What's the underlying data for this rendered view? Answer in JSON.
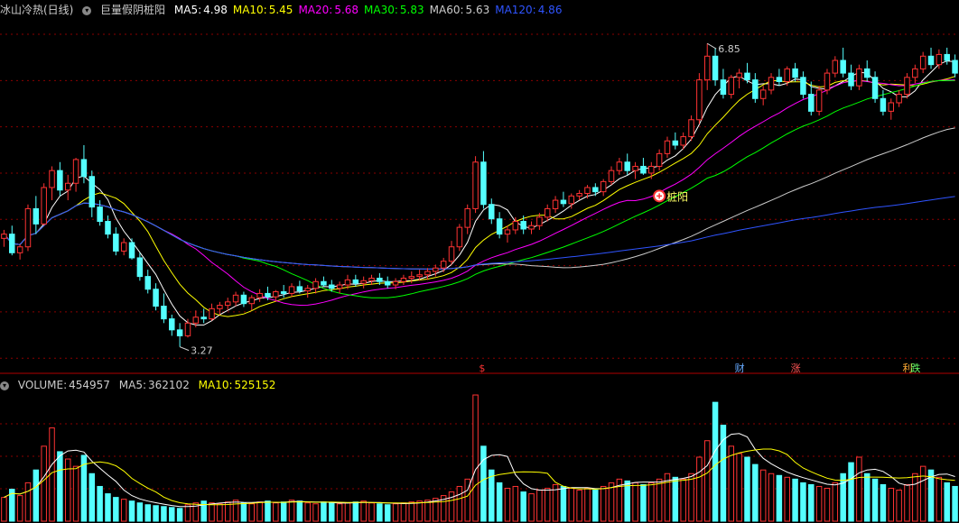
{
  "header": {
    "title": "冰山冷热(日线)",
    "indicator": "巨量假阴桩阳",
    "ma": [
      {
        "label": "MA5:",
        "value": "4.98",
        "color": "#ffffff"
      },
      {
        "label": "MA10:",
        "value": "5.45",
        "color": "#ffff00"
      },
      {
        "label": "MA20:",
        "value": "5.68",
        "color": "#ff00ff"
      },
      {
        "label": "MA30:",
        "value": "5.83",
        "color": "#00ff00"
      },
      {
        "label": "MA60:",
        "value": "5.63",
        "color": "#cccccc"
      },
      {
        "label": "MA120:",
        "value": "4.86",
        "color": "#2f54ff"
      }
    ]
  },
  "vol_header": {
    "label": "VOLUME:",
    "value": "454957",
    "ma5_label": "MA5:",
    "ma5": "362102",
    "ma10_label": "MA10:",
    "ma10": "525152"
  },
  "annotations": {
    "high": "6.85",
    "low": "3.27",
    "signal": "桩阳",
    "markers": [
      {
        "text": "$",
        "color": "#ff3333"
      },
      {
        "text": "财",
        "color": "#66aaff"
      },
      {
        "text": "涨",
        "color": "#ff5555"
      },
      {
        "text": "利",
        "color": "#ffaa33"
      },
      {
        "text": "跌",
        "color": "#66ff66"
      }
    ]
  },
  "colors": {
    "up": "#ff3333",
    "down": "#54ffff",
    "grid": "#8a0000",
    "ma120": "#2f54ff"
  },
  "chart_data": {
    "type": "candlestick",
    "price_range": [
      3.0,
      7.15
    ],
    "candles": [
      [
        4.55,
        4.65,
        4.45,
        4.6
      ],
      [
        4.6,
        4.7,
        4.35,
        4.38
      ],
      [
        4.38,
        4.48,
        4.3,
        4.45
      ],
      [
        4.45,
        4.95,
        4.4,
        4.9
      ],
      [
        4.9,
        5.05,
        4.6,
        4.72
      ],
      [
        4.72,
        5.2,
        4.7,
        5.15
      ],
      [
        5.15,
        5.4,
        5.0,
        5.35
      ],
      [
        5.35,
        5.45,
        5.05,
        5.12
      ],
      [
        5.12,
        5.3,
        5.0,
        5.2
      ],
      [
        5.2,
        5.5,
        5.1,
        5.48
      ],
      [
        5.48,
        5.65,
        5.2,
        5.28
      ],
      [
        5.28,
        5.35,
        4.8,
        4.92
      ],
      [
        4.92,
        5.0,
        4.7,
        4.75
      ],
      [
        4.75,
        4.82,
        4.55,
        4.6
      ],
      [
        4.6,
        4.68,
        4.35,
        4.4
      ],
      [
        4.4,
        4.55,
        4.35,
        4.5
      ],
      [
        4.5,
        4.55,
        4.3,
        4.32
      ],
      [
        4.32,
        4.38,
        4.05,
        4.1
      ],
      [
        4.1,
        4.18,
        3.9,
        3.95
      ],
      [
        3.95,
        4.02,
        3.7,
        3.75
      ],
      [
        3.75,
        3.9,
        3.55,
        3.6
      ],
      [
        3.6,
        3.65,
        3.4,
        3.47
      ],
      [
        3.47,
        3.55,
        3.27,
        3.4
      ],
      [
        3.4,
        3.6,
        3.38,
        3.55
      ],
      [
        3.55,
        3.7,
        3.5,
        3.62
      ],
      [
        3.62,
        3.72,
        3.55,
        3.6
      ],
      [
        3.6,
        3.78,
        3.58,
        3.72
      ],
      [
        3.72,
        3.8,
        3.65,
        3.76
      ],
      [
        3.76,
        3.85,
        3.7,
        3.8
      ],
      [
        3.8,
        3.92,
        3.75,
        3.88
      ],
      [
        3.88,
        3.92,
        3.74,
        3.78
      ],
      [
        3.78,
        3.88,
        3.7,
        3.85
      ],
      [
        3.85,
        3.95,
        3.8,
        3.9
      ],
      [
        3.9,
        3.98,
        3.82,
        3.86
      ],
      [
        3.86,
        3.94,
        3.8,
        3.92
      ],
      [
        3.92,
        4.0,
        3.85,
        3.9
      ],
      [
        3.9,
        4.02,
        3.86,
        3.98
      ],
      [
        3.98,
        4.05,
        3.9,
        3.93
      ],
      [
        3.93,
        4.0,
        3.85,
        3.96
      ],
      [
        3.96,
        4.08,
        3.9,
        4.04
      ],
      [
        4.04,
        4.1,
        3.98,
        4.0
      ],
      [
        4.0,
        4.06,
        3.92,
        3.96
      ],
      [
        3.96,
        4.04,
        3.9,
        4.0
      ],
      [
        4.0,
        4.12,
        3.95,
        4.06
      ],
      [
        4.06,
        4.12,
        3.98,
        4.02
      ],
      [
        4.02,
        4.1,
        3.96,
        4.05
      ],
      [
        4.05,
        4.12,
        4.0,
        4.08
      ],
      [
        4.08,
        4.14,
        4.0,
        4.04
      ],
      [
        4.04,
        4.1,
        3.96,
        4.0
      ],
      [
        4.0,
        4.08,
        3.95,
        4.04
      ],
      [
        4.04,
        4.12,
        4.0,
        4.08
      ],
      [
        4.08,
        4.16,
        4.02,
        4.1
      ],
      [
        4.1,
        4.18,
        4.05,
        4.12
      ],
      [
        4.12,
        4.2,
        4.06,
        4.16
      ],
      [
        4.16,
        4.24,
        4.1,
        4.2
      ],
      [
        4.2,
        4.32,
        4.15,
        4.28
      ],
      [
        4.28,
        4.52,
        4.24,
        4.45
      ],
      [
        4.45,
        4.72,
        4.4,
        4.68
      ],
      [
        4.68,
        4.95,
        4.6,
        4.9
      ],
      [
        4.9,
        5.52,
        4.85,
        5.45
      ],
      [
        5.45,
        5.58,
        4.9,
        4.95
      ],
      [
        4.95,
        5.02,
        4.72,
        4.78
      ],
      [
        4.78,
        4.86,
        4.55,
        4.6
      ],
      [
        4.6,
        4.7,
        4.5,
        4.65
      ],
      [
        4.65,
        4.8,
        4.6,
        4.75
      ],
      [
        4.75,
        4.82,
        4.6,
        4.66
      ],
      [
        4.66,
        4.75,
        4.6,
        4.7
      ],
      [
        4.7,
        4.85,
        4.65,
        4.8
      ],
      [
        4.8,
        4.95,
        4.75,
        4.9
      ],
      [
        4.9,
        5.05,
        4.85,
        5.0
      ],
      [
        5.0,
        5.1,
        4.92,
        4.96
      ],
      [
        4.96,
        5.08,
        4.9,
        5.05
      ],
      [
        5.05,
        5.12,
        5.0,
        5.08
      ],
      [
        5.08,
        5.18,
        5.02,
        5.15
      ],
      [
        5.15,
        5.2,
        5.05,
        5.1
      ],
      [
        5.1,
        5.25,
        5.05,
        5.22
      ],
      [
        5.22,
        5.4,
        5.18,
        5.35
      ],
      [
        5.35,
        5.5,
        5.3,
        5.45
      ],
      [
        5.45,
        5.55,
        5.3,
        5.35
      ],
      [
        5.35,
        5.45,
        5.25,
        5.4
      ],
      [
        5.4,
        5.5,
        5.3,
        5.32
      ],
      [
        5.32,
        5.45,
        5.25,
        5.4
      ],
      [
        5.4,
        5.6,
        5.35,
        5.55
      ],
      [
        5.55,
        5.75,
        5.5,
        5.7
      ],
      [
        5.7,
        5.8,
        5.6,
        5.65
      ],
      [
        5.65,
        5.8,
        5.6,
        5.75
      ],
      [
        5.75,
        6.0,
        5.7,
        5.95
      ],
      [
        5.95,
        6.5,
        5.9,
        6.42
      ],
      [
        6.42,
        6.85,
        6.3,
        6.7
      ],
      [
        6.7,
        6.8,
        6.35,
        6.42
      ],
      [
        6.42,
        6.55,
        6.2,
        6.25
      ],
      [
        6.25,
        6.48,
        6.2,
        6.45
      ],
      [
        6.45,
        6.55,
        6.32,
        6.5
      ],
      [
        6.5,
        6.62,
        6.38,
        6.42
      ],
      [
        6.42,
        6.5,
        6.15,
        6.2
      ],
      [
        6.2,
        6.35,
        6.12,
        6.3
      ],
      [
        6.3,
        6.5,
        6.25,
        6.45
      ],
      [
        6.45,
        6.55,
        6.35,
        6.4
      ],
      [
        6.4,
        6.58,
        6.35,
        6.55
      ],
      [
        6.55,
        6.62,
        6.4,
        6.45
      ],
      [
        6.45,
        6.52,
        6.2,
        6.25
      ],
      [
        6.25,
        6.4,
        6.0,
        6.05
      ],
      [
        6.05,
        6.35,
        6.0,
        6.3
      ],
      [
        6.3,
        6.55,
        6.25,
        6.5
      ],
      [
        6.5,
        6.7,
        6.45,
        6.65
      ],
      [
        6.65,
        6.8,
        6.45,
        6.5
      ],
      [
        6.5,
        6.6,
        6.3,
        6.35
      ],
      [
        6.35,
        6.6,
        6.3,
        6.55
      ],
      [
        6.55,
        6.65,
        6.4,
        6.45
      ],
      [
        6.45,
        6.52,
        6.15,
        6.2
      ],
      [
        6.2,
        6.3,
        6.0,
        6.05
      ],
      [
        6.05,
        6.2,
        5.95,
        6.15
      ],
      [
        6.15,
        6.3,
        6.1,
        6.25
      ],
      [
        6.25,
        6.5,
        6.2,
        6.45
      ],
      [
        6.45,
        6.6,
        6.38,
        6.55
      ],
      [
        6.55,
        6.75,
        6.5,
        6.7
      ],
      [
        6.7,
        6.8,
        6.55,
        6.6
      ],
      [
        6.6,
        6.78,
        6.55,
        6.72
      ],
      [
        6.72,
        6.8,
        6.6,
        6.65
      ],
      [
        6.65,
        6.72,
        6.45,
        6.5
      ]
    ],
    "volume_range": [
      0,
      1400000
    ],
    "volumes": [
      260000,
      350000,
      280000,
      420000,
      560000,
      820000,
      1020000,
      760000,
      680000,
      600000,
      720000,
      520000,
      380000,
      300000,
      260000,
      240000,
      220000,
      200000,
      180000,
      170000,
      160000,
      150000,
      140000,
      180000,
      200000,
      220000,
      200000,
      190000,
      210000,
      230000,
      200000,
      190000,
      210000,
      220000,
      200000,
      210000,
      230000,
      220000,
      200000,
      190000,
      210000,
      200000,
      190000,
      200000,
      210000,
      220000,
      200000,
      190000,
      180000,
      190000,
      200000,
      210000,
      220000,
      230000,
      250000,
      280000,
      320000,
      380000,
      460000,
      1380000,
      820000,
      560000,
      420000,
      360000,
      380000,
      320000,
      300000,
      340000,
      360000,
      400000,
      380000,
      360000,
      340000,
      360000,
      340000,
      380000,
      420000,
      460000,
      440000,
      420000,
      400000,
      420000,
      460000,
      520000,
      480000,
      460000,
      520000,
      700000,
      880000,
      1300000,
      1050000,
      820000,
      740000,
      700000,
      620000,
      560000,
      520000,
      500000,
      480000,
      460000,
      420000,
      400000,
      380000,
      360000,
      420000,
      520000,
      640000,
      700000,
      520000,
      460000,
      400000,
      360000,
      340000,
      400000,
      520000,
      600000,
      560000,
      480000,
      420000,
      380000
    ]
  }
}
